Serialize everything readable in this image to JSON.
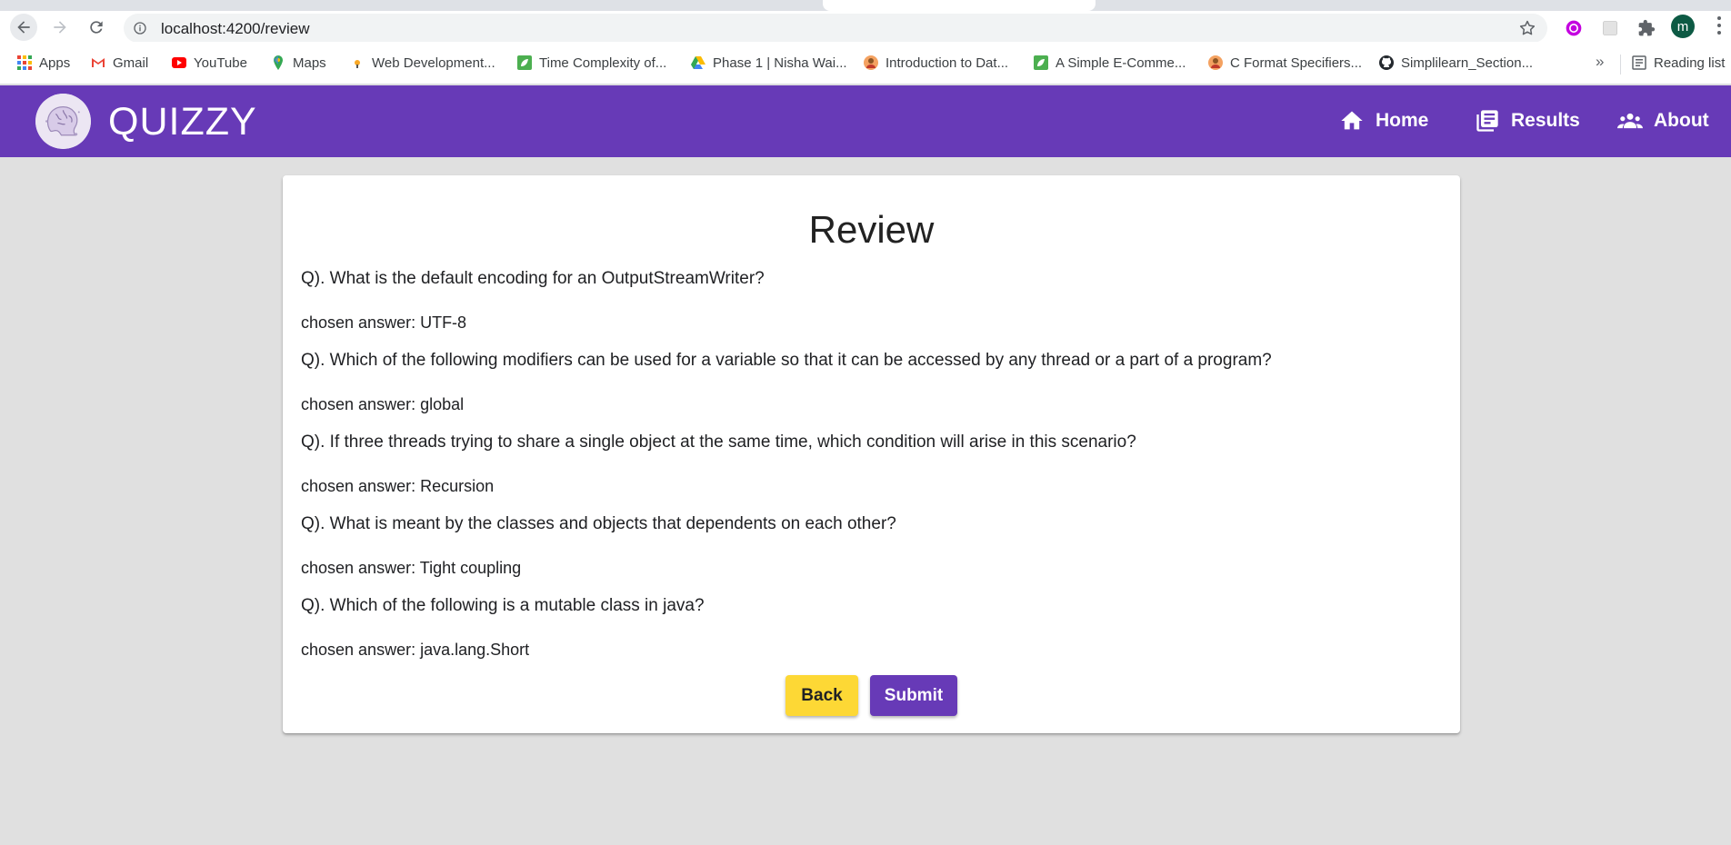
{
  "browser": {
    "url": "localhost:4200/review",
    "avatar_letter": "m",
    "bookmarks": [
      {
        "label": "Apps",
        "icon": "apps-grid-icon"
      },
      {
        "label": "Gmail",
        "icon": "gmail-icon"
      },
      {
        "label": "YouTube",
        "icon": "youtube-icon"
      },
      {
        "label": "Maps",
        "icon": "maps-icon"
      },
      {
        "label": "Web Development...",
        "icon": "web-dev-icon"
      },
      {
        "label": "Time Complexity of...",
        "icon": "leaf-icon"
      },
      {
        "label": "Phase 1 | Nisha Wai...",
        "icon": "drive-icon"
      },
      {
        "label": "Introduction to Dat...",
        "icon": "person-avatar-icon"
      },
      {
        "label": "A Simple E-Comme...",
        "icon": "leaf-icon"
      },
      {
        "label": "C Format Specifiers...",
        "icon": "person-avatar-icon"
      },
      {
        "label": "Simplilearn_Section...",
        "icon": "github-icon"
      }
    ],
    "bookmarks_overflow": "»",
    "reading_list": "Reading list"
  },
  "header": {
    "title": "QUIZZY",
    "nav": [
      {
        "label": "Home",
        "icon": "home-icon"
      },
      {
        "label": "Results",
        "icon": "results-icon"
      },
      {
        "label": "About",
        "icon": "people-icon"
      }
    ]
  },
  "review": {
    "title": "Review",
    "items": [
      {
        "question": "Q). What is the default encoding for an OutputStreamWriter?",
        "answer": "chosen answer: UTF-8"
      },
      {
        "question": "Q). Which of the following modifiers can be used for a variable so that it can be accessed by any thread or a part of a program?",
        "answer": "chosen answer: global"
      },
      {
        "question": "Q). If three threads trying to share a single object at the same time, which condition will arise in this scenario?",
        "answer": "chosen answer: Recursion"
      },
      {
        "question": "Q). What is meant by the classes and objects that dependents on each other?",
        "answer": "chosen answer: Tight coupling"
      },
      {
        "question": "Q). Which of the following is a mutable class in java?",
        "answer": "chosen answer: java.lang.Short"
      }
    ],
    "back_label": "Back",
    "submit_label": "Submit"
  },
  "colors": {
    "primary": "#673ab7",
    "accent": "#fdd835",
    "background": "#e0e0e0"
  }
}
